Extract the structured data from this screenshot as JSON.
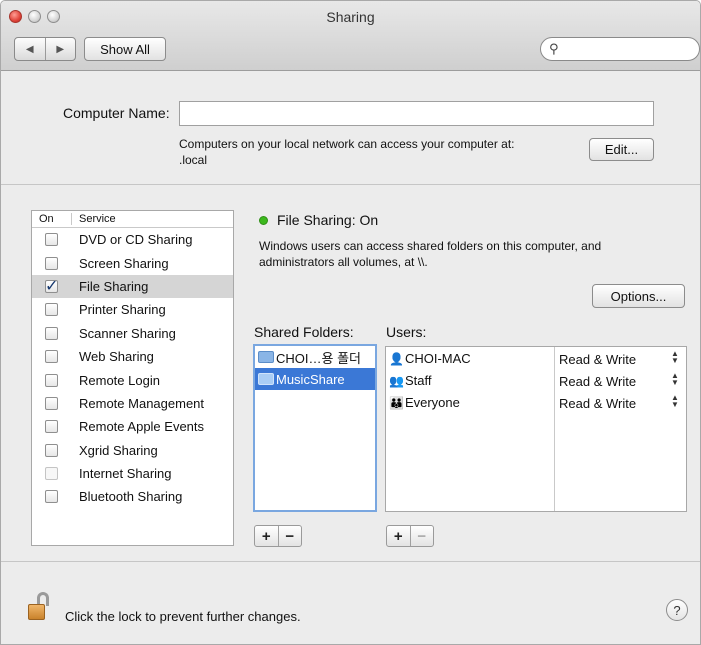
{
  "window": {
    "title": "Sharing"
  },
  "toolbar": {
    "back": "◀",
    "forward": "▶",
    "show_all": "Show All",
    "search_placeholder": ""
  },
  "computer_name": {
    "label": "Computer Name:",
    "value": "",
    "help_line1": "Computers on your local network can access your computer at:",
    "help_line2": ".local",
    "edit_label": "Edit..."
  },
  "services": {
    "header_on": "On",
    "header_service": "Service",
    "items": [
      {
        "label": "DVD or CD Sharing",
        "checked": false,
        "enabled": true
      },
      {
        "label": "Screen Sharing",
        "checked": false,
        "enabled": true
      },
      {
        "label": "File Sharing",
        "checked": true,
        "enabled": true,
        "selected": true
      },
      {
        "label": "Printer Sharing",
        "checked": false,
        "enabled": true
      },
      {
        "label": "Scanner Sharing",
        "checked": false,
        "enabled": true
      },
      {
        "label": "Web Sharing",
        "checked": false,
        "enabled": true
      },
      {
        "label": "Remote Login",
        "checked": false,
        "enabled": true
      },
      {
        "label": "Remote Management",
        "checked": false,
        "enabled": true
      },
      {
        "label": "Remote Apple Events",
        "checked": false,
        "enabled": true
      },
      {
        "label": "Xgrid Sharing",
        "checked": false,
        "enabled": true
      },
      {
        "label": "Internet Sharing",
        "checked": false,
        "enabled": false
      },
      {
        "label": "Bluetooth Sharing",
        "checked": false,
        "enabled": true
      }
    ]
  },
  "detail": {
    "status": "File Sharing: On",
    "status_color": "#3cb81d",
    "description_line1": "Windows users can access shared folders on this computer, and",
    "description_line2": "administrators all volumes, at \\\\.",
    "options_label": "Options...",
    "shared_folders_label": "Shared Folders:",
    "users_label": "Users:",
    "shared_folders": [
      {
        "name": "CHOI…용 폴더",
        "selected": false
      },
      {
        "name": "MusicShare",
        "selected": true
      }
    ],
    "users": [
      {
        "name": "CHOI-MAC",
        "permission": "Read & Write",
        "icon": "user-icon"
      },
      {
        "name": "Staff",
        "permission": "Read & Write",
        "icon": "group-icon"
      },
      {
        "name": "Everyone",
        "permission": "Read & Write",
        "icon": "everyone-icon"
      }
    ],
    "add": "+",
    "remove": "−"
  },
  "footer": {
    "lock_text": "Click the lock to prevent further changes.",
    "help": "?"
  }
}
